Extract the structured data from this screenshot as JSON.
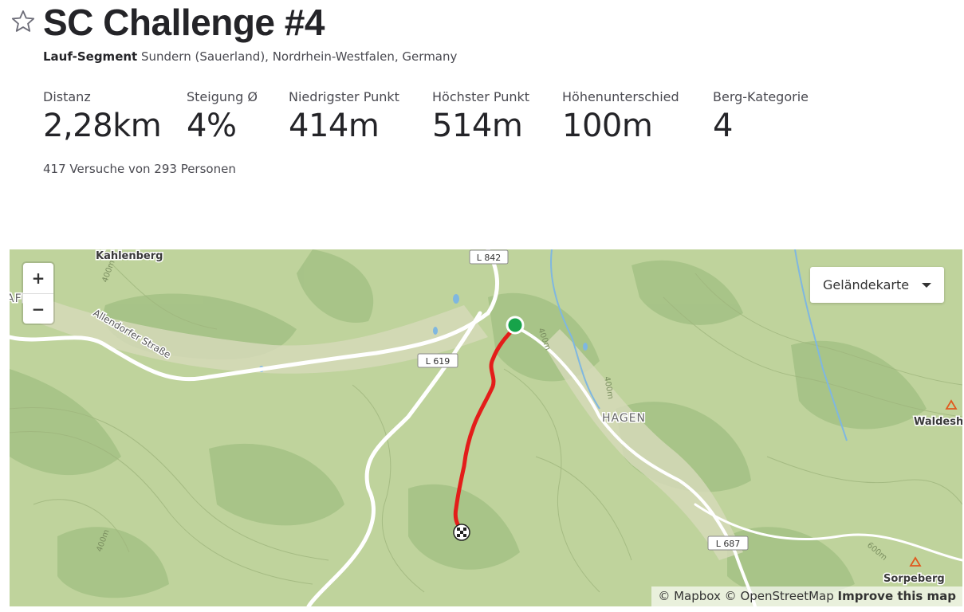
{
  "header": {
    "title": "SC Challenge #4",
    "segment_type": "Lauf-Segment",
    "location": "Sundern (Sauerland), Nordrhein-Westfalen, Germany"
  },
  "stats": [
    {
      "label": "Distanz",
      "value": "2,28km"
    },
    {
      "label": "Steigung Ø",
      "value": "4%"
    },
    {
      "label": "Niedrigster Punkt",
      "value": "414m"
    },
    {
      "label": "Höchster Punkt",
      "value": "514m"
    },
    {
      "label": "Höhenunterschied",
      "value": "100m"
    },
    {
      "label": "Berg-Kategorie",
      "value": "4"
    }
  ],
  "attempts": "417 Versuche von 293 Personen",
  "map": {
    "zoom_in": "+",
    "zoom_out": "−",
    "layer_select": "Geländekarte",
    "places": {
      "kahlenberg": "Kahlenberg",
      "affeln": "AFFELN",
      "hagen": "HAGEN",
      "waldesh": "Waldesh",
      "sorpeberg": "Sorpeberg"
    },
    "streets": {
      "allendorfer": "Allendorfer Straße"
    },
    "road_shields": {
      "l842": "L 842",
      "l619": "L 619",
      "l687": "L 687"
    },
    "contours": {
      "c1": "400m",
      "c2": "400m",
      "c3": "400m",
      "c4": "400m",
      "c5": "600m"
    },
    "attribution": {
      "mapbox": "© Mapbox",
      "osm": "© OpenStreetMap",
      "improve": "Improve this map"
    },
    "colors": {
      "terrain": "#bfd39c",
      "forest": "#a5c286",
      "route": "#e31d1a",
      "start_marker": "#17a34a",
      "water": "#7fb7e0"
    }
  }
}
